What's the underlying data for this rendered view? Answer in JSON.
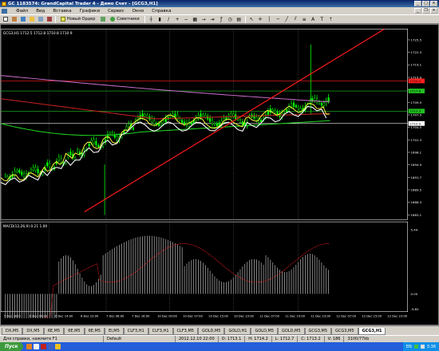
{
  "window": {
    "title": "GC 1183574: GrandCapital Trader 4 - Демо Счет - [GCG3,H1]"
  },
  "menu": {
    "items": [
      "Файл",
      "Вид",
      "Вставка",
      "Графики",
      "Сервис",
      "Окно",
      "Справка"
    ]
  },
  "toolbar": {
    "new_order": "Новый Ордер",
    "experts": "Советники"
  },
  "chart": {
    "header": "GCG3,H1  1712.5 1712.8 1710.8 1710.9",
    "macd_label": "MACD(12,26,9) 0.21 1.00",
    "price_ticks": [
      "1725.5",
      "1722.3",
      "1719.1",
      "1715.9",
      "1712.7",
      "1709.5",
      "1707.5",
      "1704.5",
      "1701.3",
      "1698.1",
      "1694.9",
      "1691.7",
      "1689.5",
      "1686.3",
      "1683.1"
    ],
    "price_markers": [
      {
        "label": "1720.4",
        "color": "#ff2020"
      },
      {
        "label": "1717.6",
        "color": "#20c020"
      },
      {
        "label": "1713.3",
        "color": "#20c020"
      },
      {
        "label": "1710.9",
        "color": "#ffffff"
      }
    ],
    "macd_ticks": [
      "5.44",
      "0.00",
      "-5.82"
    ],
    "time_ticks": [
      "5 Dec 2012",
      "6 Dec 06:00",
      "6 Dec 14:00",
      "6 Dec 22:00",
      "7 Dec 08:00",
      "7 Dec 16:00",
      "10 Dec 00:00",
      "10 Dec 07:00",
      "10 Dec 15:00",
      "10 Dec 23:00",
      "11 Dec 07:00",
      "11 Dec 15:00",
      "11 Dec 23:00",
      "12 Dec 07:00",
      "12 Dec 15:00",
      "12 Dec 23:00"
    ]
  },
  "tabs": [
    "DX,M5",
    "DX,M5",
    "6E,M5",
    "6E,M5",
    "6E,M5",
    "EI,M5",
    "CLF3,H1",
    "CLF3,H1",
    "CLF3,M5",
    "GOLD,M5",
    "GOLD,H1",
    "GOLD,M5",
    "GOLD,M5",
    "GCG3,M5",
    "GCG3,M5",
    "GCG3,H1"
  ],
  "active_tab": "GCG3,H1",
  "status": {
    "help": "Для справки, нажмите F1",
    "profile": "Default",
    "datetime": "2012.12.10 22:00",
    "open": "O: 1713.1",
    "high": "H: 1714.2",
    "low": "L: 1712.7",
    "close": "C: 1713.2",
    "volume": "V: 186",
    "traffic": "3100/77kb"
  },
  "taskbar": {
    "start": "Пуск",
    "lang": "EN",
    "clock": "3:36"
  },
  "colors": {
    "red_line": "#ff1a1a",
    "magenta_ma": "#d070d0",
    "green_ma": "#20d020",
    "yellow_ma": "#ffff40",
    "white_ma": "#ffffff"
  }
}
